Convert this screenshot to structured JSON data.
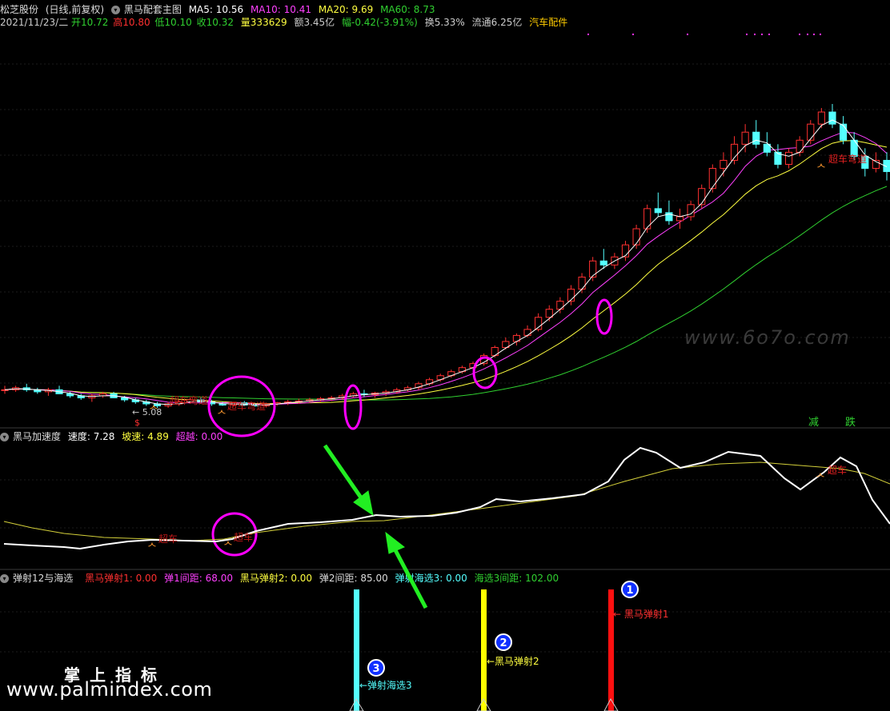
{
  "header1": {
    "stock": "松芝股份",
    "mode": "(日线,前复权)",
    "indicator": "黑马配套主图",
    "ma5": "MA5: 10.56",
    "ma10": "MA10: 10.41",
    "ma20": "MA20: 9.69",
    "ma60": "MA60: 8.73"
  },
  "header2": {
    "date": "2021/11/23/二",
    "open": "开10.72",
    "high": "高10.80",
    "low": "低10.10",
    "close": "收10.32",
    "vol": "量333629",
    "amount": "额3.45亿",
    "change": "幅-0.42(-3.91%)",
    "turnover": "换5.33%",
    "float": "流通6.25亿",
    "sector": "汽车配件"
  },
  "panel2": {
    "name": "黑马加速度",
    "speed": "速度: 7.28",
    "slope": "坡速: 4.89",
    "over": "超越: 0.00"
  },
  "panel3": {
    "name": "弹射12与海选",
    "s1": "黑马弹射1: 0.00",
    "gap1": "弹1间距: 68.00",
    "s2": "黑马弹射2: 0.00",
    "gap2": "弹2间距: 85.00",
    "s3": "弹射海选3: 0.00",
    "gap3": "海选3间距: 102.00"
  },
  "annotations": {
    "low_price": "5.08",
    "low_marker": "$",
    "reduce": "减",
    "fall": "跌",
    "signal_label_1": "超车弯道",
    "signal_label_2": "超车弯道",
    "signal_label_3": "超车弯道",
    "overtake": "超车",
    "bar1_label": "← 黑马弹射1",
    "bar2_label": "←黑马弹射2",
    "bar3_label": "←弹射海选3",
    "badge1": "1",
    "badge2": "2",
    "badge3": "3"
  },
  "watermarks": {
    "site": "www.palmindex.com",
    "cn": "掌上指标",
    "site2": "www.6o7o.com"
  },
  "colors": {
    "up": "#ff3030",
    "down": "#54ffff",
    "ma5": "#ffffff",
    "ma10": "#ff40ff",
    "ma20": "#ffff40",
    "ma60": "#30d030",
    "highlight": "#ff00ff",
    "arrow": "#22ee22"
  },
  "chart_data": {
    "type": "candlestick",
    "candles": [
      [
        4.9,
        5.0,
        4.8,
        4.9
      ],
      [
        4.9,
        5.0,
        4.85,
        4.95
      ],
      [
        4.95,
        5.05,
        4.85,
        4.9
      ],
      [
        4.9,
        4.95,
        4.8,
        4.85
      ],
      [
        4.85,
        4.95,
        4.75,
        4.9
      ],
      [
        4.9,
        5.0,
        4.8,
        4.8
      ],
      [
        4.8,
        4.85,
        4.7,
        4.75
      ],
      [
        4.75,
        4.8,
        4.65,
        4.7
      ],
      [
        4.7,
        4.8,
        4.6,
        4.75
      ],
      [
        4.75,
        4.85,
        4.7,
        4.8
      ],
      [
        4.8,
        4.85,
        4.7,
        4.7
      ],
      [
        4.7,
        4.75,
        4.6,
        4.65
      ],
      [
        4.65,
        4.7,
        4.55,
        4.6
      ],
      [
        4.6,
        4.65,
        4.5,
        4.55
      ],
      [
        4.55,
        4.6,
        4.45,
        4.5
      ],
      [
        4.5,
        4.6,
        4.45,
        4.55
      ],
      [
        4.55,
        4.65,
        4.5,
        4.6
      ],
      [
        4.6,
        4.7,
        4.55,
        4.65
      ],
      [
        4.65,
        4.7,
        4.55,
        4.6
      ],
      [
        4.6,
        4.65,
        4.5,
        4.55
      ],
      [
        4.55,
        4.6,
        4.5,
        4.52
      ],
      [
        4.52,
        4.6,
        4.48,
        4.58
      ],
      [
        4.58,
        4.62,
        4.5,
        4.52
      ],
      [
        4.52,
        4.56,
        4.48,
        4.5
      ],
      [
        4.5,
        4.58,
        4.46,
        4.55
      ],
      [
        4.55,
        4.6,
        4.5,
        4.58
      ],
      [
        4.58,
        4.65,
        4.52,
        4.6
      ],
      [
        4.6,
        4.68,
        4.55,
        4.62
      ],
      [
        4.62,
        4.7,
        4.58,
        4.65
      ],
      [
        4.65,
        4.72,
        4.6,
        4.68
      ],
      [
        4.68,
        4.75,
        4.62,
        4.7
      ],
      [
        4.7,
        4.8,
        4.65,
        4.75
      ],
      [
        4.75,
        4.85,
        4.7,
        4.8
      ],
      [
        4.8,
        4.9,
        4.72,
        4.78
      ],
      [
        4.78,
        4.85,
        4.7,
        4.82
      ],
      [
        4.82,
        4.9,
        4.75,
        4.85
      ],
      [
        4.85,
        4.95,
        4.8,
        4.9
      ],
      [
        4.9,
        5.0,
        4.85,
        4.95
      ],
      [
        4.95,
        5.1,
        4.9,
        5.05
      ],
      [
        5.05,
        5.2,
        5.0,
        5.15
      ],
      [
        5.15,
        5.3,
        5.1,
        5.25
      ],
      [
        5.25,
        5.4,
        5.2,
        5.35
      ],
      [
        5.35,
        5.5,
        5.3,
        5.45
      ],
      [
        5.45,
        5.6,
        5.4,
        5.55
      ],
      [
        5.55,
        5.8,
        5.5,
        5.75
      ],
      [
        5.75,
        6.0,
        5.7,
        5.95
      ],
      [
        5.95,
        6.2,
        5.9,
        6.1
      ],
      [
        6.1,
        6.3,
        6.0,
        6.25
      ],
      [
        6.25,
        6.5,
        6.2,
        6.4
      ],
      [
        6.4,
        6.8,
        6.35,
        6.7
      ],
      [
        6.7,
        7.0,
        6.6,
        6.9
      ],
      [
        6.9,
        7.2,
        6.8,
        7.1
      ],
      [
        7.1,
        7.5,
        7.0,
        7.4
      ],
      [
        7.4,
        7.8,
        7.3,
        7.7
      ],
      [
        7.7,
        8.2,
        7.6,
        8.1
      ],
      [
        8.1,
        8.4,
        7.9,
        8.0
      ],
      [
        8.0,
        8.3,
        7.9,
        8.2
      ],
      [
        8.2,
        8.6,
        8.1,
        8.5
      ],
      [
        8.5,
        9.0,
        8.4,
        8.9
      ],
      [
        8.9,
        9.5,
        8.8,
        9.4
      ],
      [
        9.4,
        9.8,
        9.2,
        9.3
      ],
      [
        9.3,
        9.6,
        9.0,
        9.1
      ],
      [
        9.1,
        9.4,
        8.9,
        9.2
      ],
      [
        9.2,
        9.6,
        9.1,
        9.5
      ],
      [
        9.5,
        10.0,
        9.4,
        9.9
      ],
      [
        9.9,
        10.5,
        9.8,
        10.4
      ],
      [
        10.4,
        10.8,
        10.2,
        10.6
      ],
      [
        10.6,
        11.2,
        10.5,
        11.0
      ],
      [
        11.0,
        11.5,
        10.8,
        11.3
      ],
      [
        11.3,
        11.6,
        10.9,
        11.0
      ],
      [
        11.0,
        11.3,
        10.7,
        10.8
      ],
      [
        10.8,
        11.0,
        10.4,
        10.5
      ],
      [
        10.5,
        10.9,
        10.4,
        10.8
      ],
      [
        10.8,
        11.2,
        10.7,
        11.1
      ],
      [
        11.1,
        11.6,
        11.0,
        11.5
      ],
      [
        11.5,
        11.9,
        11.4,
        11.8
      ],
      [
        11.8,
        12.0,
        11.4,
        11.5
      ],
      [
        11.5,
        11.7,
        11.0,
        11.1
      ],
      [
        11.1,
        11.3,
        10.6,
        10.7
      ],
      [
        10.7,
        10.9,
        10.2,
        10.4
      ],
      [
        10.4,
        10.8,
        10.3,
        10.6
      ],
      [
        10.6,
        10.8,
        10.1,
        10.32
      ]
    ],
    "speed": [
      7.28
    ],
    "slope": [
      4.89
    ]
  }
}
